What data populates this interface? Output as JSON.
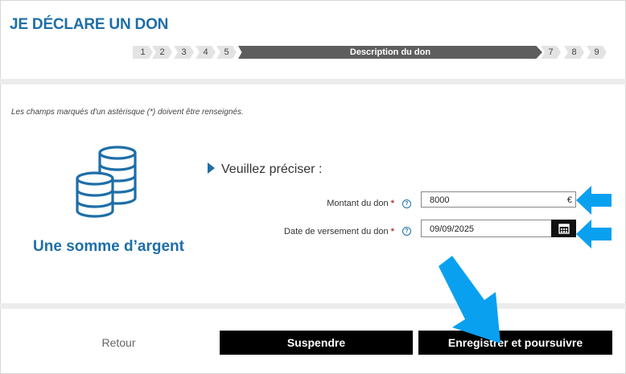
{
  "page": {
    "title": "JE DÉCLARE UN DON",
    "hint": "Les champs marqués d'un astérisque (*) doivent être renseignés."
  },
  "stepper": {
    "steps_before": [
      "1",
      "2",
      "3",
      "4",
      "5"
    ],
    "active_label": "Description du don",
    "steps_after": [
      "7",
      "8",
      "9"
    ]
  },
  "category": {
    "icon": "coins-stack-icon",
    "label": "Une somme d’argent"
  },
  "form": {
    "heading": "Veuillez préciser :",
    "amount": {
      "label": "Montant du don",
      "required": "*",
      "value": "8000",
      "unit": "€",
      "help": "?"
    },
    "date": {
      "label": "Date de versement du don",
      "required": "*",
      "value": "09/09/2025",
      "help": "?"
    }
  },
  "actions": {
    "back_label": "Retour",
    "suspend_label": "Suspendre",
    "save_label": "Enregistrer et poursuivre"
  },
  "colors": {
    "brand_blue": "#1e6ea8",
    "annotation_arrow": "#0aa0f0",
    "button_bg": "#000000"
  }
}
